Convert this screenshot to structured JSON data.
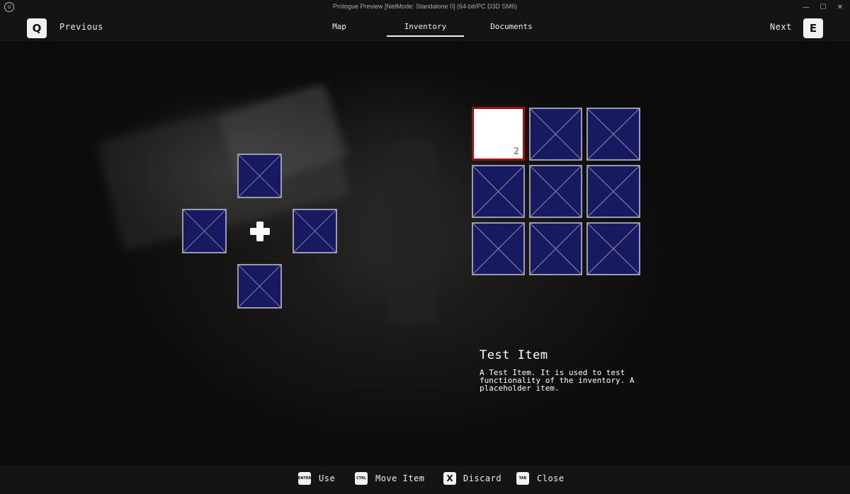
{
  "window": {
    "title": "Prologue Preview [NetMode: Standalone 0]  (64-bit/PC D3D SM6)",
    "logo_text": "U",
    "minimize_glyph": "—",
    "maximize_glyph": "☐",
    "close_glyph": "✕"
  },
  "header": {
    "prev_key": "Q",
    "prev_label": "Previous",
    "next_label": "Next",
    "next_key": "E",
    "tabs": [
      {
        "label": "Map",
        "active": false
      },
      {
        "label": "Inventory",
        "active": true
      },
      {
        "label": "Documents",
        "active": false
      }
    ]
  },
  "equipment": {
    "slots": [
      "top",
      "left",
      "right",
      "bottom"
    ],
    "center_icon": "plus-icon"
  },
  "inventory": {
    "selected_item_count": "2",
    "empty_slot_icon": "empty-slot-x-icon"
  },
  "details": {
    "name": "Test Item",
    "description": "A Test Item. It is used to test functionality of the inventory. A placeholder item."
  },
  "footer": {
    "actions": [
      {
        "key": "ENTER",
        "label": "Use"
      },
      {
        "key": "CTRL",
        "label": "Move Item"
      },
      {
        "key": "X",
        "label": "Discard"
      },
      {
        "key": "TAB",
        "label": "Close"
      }
    ]
  },
  "colors": {
    "slot_fill": "#171a60",
    "slot_border": "#9a9ab0",
    "selected_border": "#a01010",
    "background": "#0c0c0c"
  }
}
